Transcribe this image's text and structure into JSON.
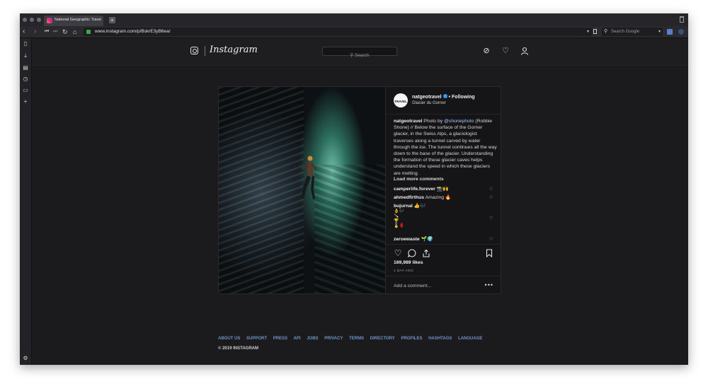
{
  "browser": {
    "tab_title": "National Geographic Travel",
    "new_tab_label": "+",
    "url": "www.instagram.com/p/BskrE3yB6ea/",
    "search_placeholder": "Search Google"
  },
  "instagram": {
    "logo_text": "Instagram",
    "search_placeholder": "Search"
  },
  "post": {
    "avatar_text": "TRAVEL",
    "username": "natgeotravel",
    "follow_label": "• Following",
    "location": "Glacier du Gorner",
    "caption": {
      "user": "natgeotravel",
      "pre_mention": " Photo by ",
      "mention": "@shonephoto",
      "text": " (Robbie Shone) // Below the surface of the Gorner glacier, in the Swiss Alps, a glaciologist traverses along a tunnel carved by water through the ice. The tunnel continues all the way down to the base of the glacier. Understanding the formation of these glacier caves helps understand the speed in which these glaciers are melting."
    },
    "load_more": "Load more comments",
    "comments": [
      {
        "user": "camperlife.forever",
        "text": " 📸🙌"
      },
      {
        "user": "ahmedfirthus",
        "text": " Amazing 🔥"
      },
      {
        "user": "bujurnal",
        "text": " 👍🎶"
      },
      {
        "user": "zeroewaste",
        "text": " 🌱🌍"
      }
    ],
    "likes_count": "169,989",
    "likes_label": "likes",
    "time_ago": "1 DAY AGO",
    "add_comment_placeholder": "Add a comment...",
    "more_label": "•••"
  },
  "footer": {
    "links": [
      "ABOUT US",
      "SUPPORT",
      "PRESS",
      "API",
      "JOBS",
      "PRIVACY",
      "TERMS",
      "DIRECTORY",
      "PROFILES",
      "HASHTAGS",
      "LANGUAGE"
    ],
    "copyright": "© 2019 INSTAGRAM"
  },
  "colors": {
    "background": "#1b1b1d",
    "link": "#6e93c8",
    "verified": "#3897f0",
    "secure": "#39a845"
  },
  "icons": [
    "back-icon",
    "forward-icon",
    "rewind-icon",
    "fast-forward-icon",
    "reload-icon",
    "home-icon",
    "lock-icon",
    "bookmark-icon",
    "search-icon",
    "compass-icon",
    "heart-icon",
    "user-icon",
    "comment-icon",
    "share-icon",
    "save-icon",
    "settings-icon"
  ]
}
